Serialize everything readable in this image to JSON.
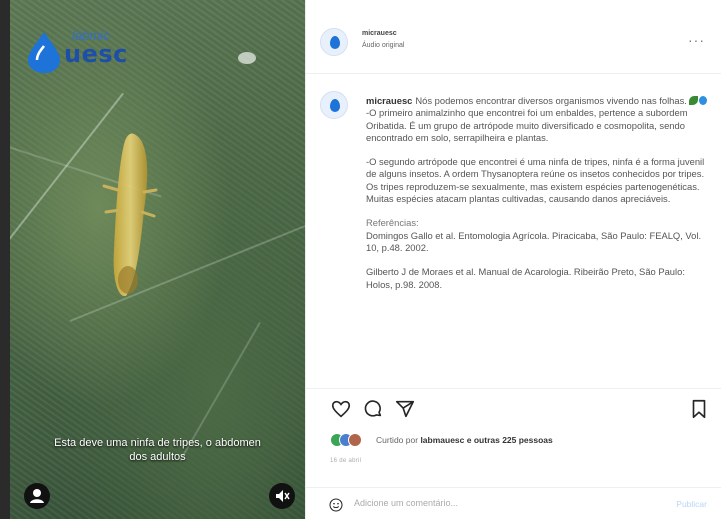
{
  "media": {
    "logo_small": "labmic",
    "logo_main": "uesc",
    "caption": "Esta deve uma ninfa de tripes, o abdomen dos adultos",
    "icons": [
      "tag-user-icon",
      "mute-icon"
    ]
  },
  "header": {
    "username": "micrauesc",
    "audio": "Áudio original",
    "more": "···"
  },
  "post": {
    "username": "micrauesc",
    "intro": "Nós podemos encontrar diversos organismos vivendo nas folhas.",
    "p1": "-O primeiro animalzinho que encontrei foi um enbaldes, pertence a subordem Oribatida. É um grupo de artrópode muito diversificado e cosmopolita, sendo encontrado em solo, serrapilheira e plantas.",
    "p2": "-O segundo artrópode que encontrei é uma ninfa de tripes, ninfa é a forma juvenil de alguns insetos. A ordem Thysanoptera reúne os insetos conhecidos por tripes. Os tripes reproduzem-se sexualmente, mas existem espécies partenogenéticas. Muitas espécies atacam plantas cultivadas, causando danos apreciáveis.",
    "ref_title": "Referências:",
    "ref1": "Domingos Gallo et al. Entomologia Agrícola. Piracicaba, São Paulo: FEALQ, Vol. 10, p.48. 2002.",
    "ref2": "Gilberto J de Moraes et al. Manual de Acarologia. Ribeirão Preto, São Paulo: Holos, p.98. 2008."
  },
  "likes": {
    "prefix": "Curtido por",
    "user": "labmauesc",
    "suffix": "e outras 225 pessoas"
  },
  "date": "16 de abril",
  "comment": {
    "placeholder": "Adicione um comentário...",
    "post_label": "Publicar"
  },
  "colors": {
    "accent": "#0095f6",
    "brand": "#1e4fa8",
    "leaf": "#4d6a48"
  }
}
